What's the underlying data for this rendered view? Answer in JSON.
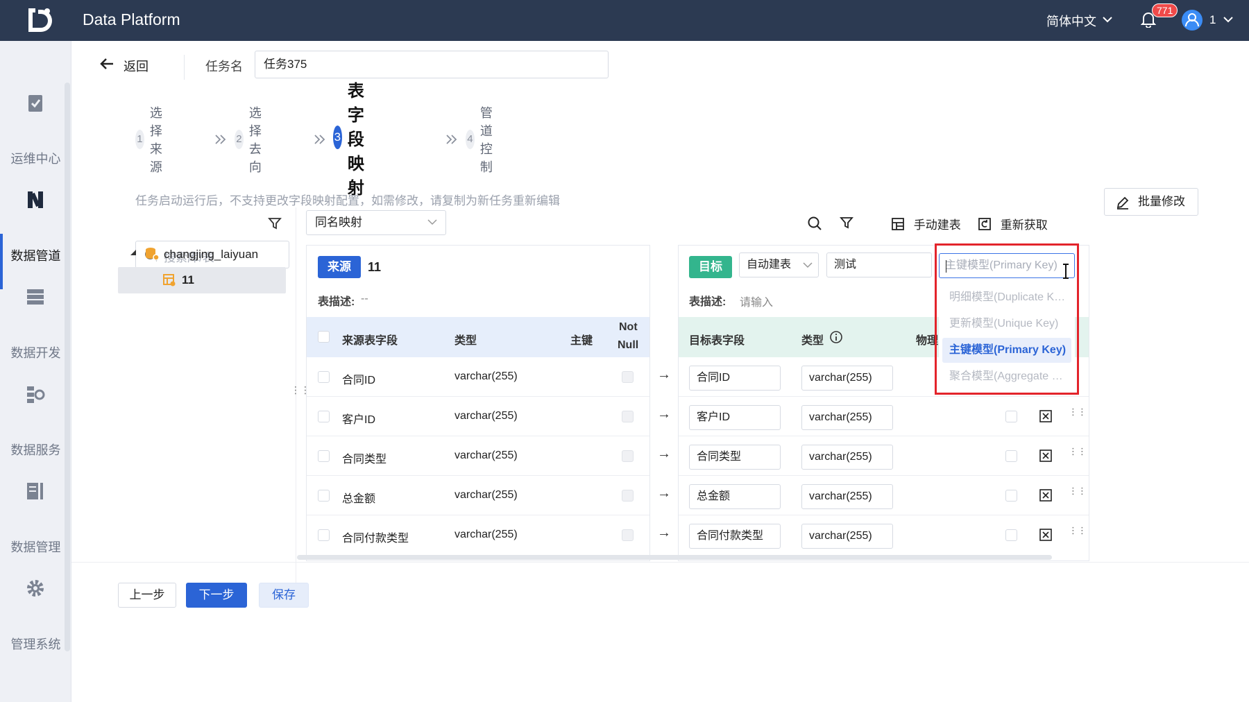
{
  "header": {
    "app_title": "Data Platform",
    "language": "简体中文",
    "notification_count": "771",
    "user_name": "1"
  },
  "sidebar": {
    "items": [
      {
        "label": "运维中心",
        "icon": "clipboard-check-icon"
      },
      {
        "label": "数据管道",
        "icon": "pipeline-icon",
        "active": true
      },
      {
        "label": "数据开发",
        "icon": "server-icon"
      },
      {
        "label": "数据服务",
        "icon": "service-icon"
      },
      {
        "label": "数据管理",
        "icon": "data-manage-icon"
      },
      {
        "label": "管理系统",
        "icon": "gear-icon"
      }
    ]
  },
  "task": {
    "back_label": "返回",
    "name_label": "任务名",
    "name_value": "任务375"
  },
  "steps": [
    {
      "num": "1",
      "label": "选择来源"
    },
    {
      "num": "2",
      "label": "选择去向"
    },
    {
      "num": "3",
      "label": "表字段映射",
      "active": true
    },
    {
      "num": "4",
      "label": "管道控制"
    }
  ],
  "notice": "任务启动运行后，不支持更改字段映射配置，如需修改，请复制为新任务重新编辑",
  "batch_edit_label": "批量修改",
  "tree": {
    "search_placeholder": "搜索库/表",
    "database": "changjing_laiyuan",
    "table": "11"
  },
  "mapping_mode": "同名映射",
  "toolbar": {
    "manual_create": "手动建表",
    "refetch": "重新获取"
  },
  "source": {
    "tag": "来源",
    "table_name": "11",
    "desc_label": "表描述:",
    "desc_value": "--",
    "columns": {
      "field": "来源表字段",
      "type": "类型",
      "pk": "主键",
      "not_null_1": "Not",
      "not_null_2": "Null"
    },
    "rows": [
      {
        "field": "合同ID",
        "type": "varchar(255)"
      },
      {
        "field": "客户ID",
        "type": "varchar(255)"
      },
      {
        "field": "合同类型",
        "type": "varchar(255)"
      },
      {
        "field": "总金额",
        "type": "varchar(255)"
      },
      {
        "field": "合同付款类型",
        "type": "varchar(255)"
      }
    ]
  },
  "target": {
    "tag": "目标",
    "create_mode": "自动建表",
    "table_name": "测试",
    "desc_label": "表描述:",
    "desc_placeholder": "请输入",
    "columns": {
      "field": "目标表字段",
      "type": "类型",
      "physical": "物理"
    },
    "rows": [
      {
        "field": "合同ID",
        "type": "varchar(255)"
      },
      {
        "field": "客户ID",
        "type": "varchar(255)"
      },
      {
        "field": "合同类型",
        "type": "varchar(255)"
      },
      {
        "field": "总金额",
        "type": "varchar(255)"
      },
      {
        "field": "合同付款类型",
        "type": "varchar(255)"
      }
    ]
  },
  "model_dropdown": {
    "placeholder": "主键模型(Primary Key)",
    "options": [
      {
        "label": "明细模型(Duplicate K…",
        "selected": false
      },
      {
        "label": "更新模型(Unique Key)",
        "selected": false
      },
      {
        "label": "主键模型(Primary Key)",
        "selected": true
      },
      {
        "label": "聚合模型(Aggregate …",
        "selected": false
      }
    ]
  },
  "footer": {
    "prev": "上一步",
    "next": "下一步",
    "save": "保存"
  },
  "colors": {
    "topbar": "#2c3a52",
    "primary": "#2b64d6",
    "target_tag": "#33b58d",
    "highlight_box": "#e3242b"
  }
}
